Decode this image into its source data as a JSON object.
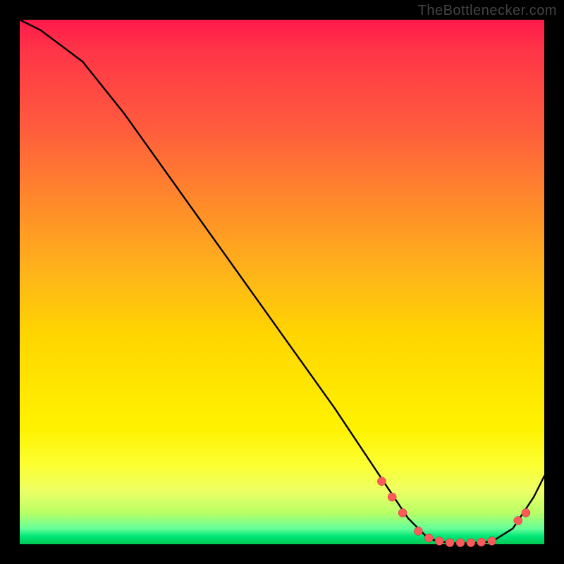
{
  "watermark": "TheBottlenecker.com",
  "colors": {
    "curve": "#000000",
    "marker": "#ff5a5a",
    "marker_stroke": "#a33"
  },
  "chart_data": {
    "type": "line",
    "title": "",
    "xlabel": "",
    "ylabel": "",
    "xlim": [
      0,
      100
    ],
    "ylim": [
      0,
      100
    ],
    "series": [
      {
        "name": "curve",
        "x": [
          0,
          4,
          8,
          12,
          20,
          30,
          40,
          50,
          60,
          68,
          74,
          78,
          82,
          86,
          90,
          94,
          98,
          100
        ],
        "y": [
          100,
          98,
          95,
          92,
          82,
          68,
          54,
          40,
          26,
          14,
          5,
          1,
          0.2,
          0.2,
          0.5,
          3,
          9,
          13
        ]
      }
    ],
    "markers": {
      "name": "highlight-points",
      "x": [
        69,
        71,
        73,
        76,
        78,
        80,
        82,
        84,
        86,
        88,
        90,
        95,
        96.5
      ],
      "y": [
        12,
        9,
        6,
        2.5,
        1.2,
        0.6,
        0.3,
        0.3,
        0.3,
        0.4,
        0.6,
        4.5,
        6
      ]
    }
  }
}
